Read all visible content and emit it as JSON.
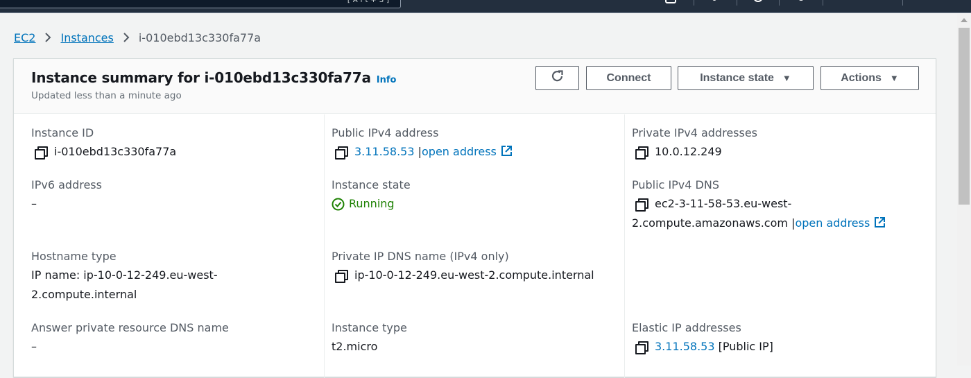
{
  "topnav": {
    "search_shortcut": "[Alt+S]",
    "icons": [
      "cloudshell-icon",
      "notifications-icon",
      "help-icon",
      "settings-icon"
    ]
  },
  "breadcrumb": {
    "items": [
      {
        "label": "EC2",
        "link": true
      },
      {
        "label": "Instances",
        "link": true
      },
      {
        "label": "i-010ebd13c330fa77a",
        "link": false
      }
    ]
  },
  "summary": {
    "title": "Instance summary for i-010ebd13c330fa77a",
    "info_label": "Info",
    "subtitle": "Updated less than a minute ago",
    "buttons": {
      "refresh": "refresh-icon",
      "connect": "Connect",
      "instance_state": "Instance state",
      "actions": "Actions"
    }
  },
  "details": {
    "instance_id": {
      "label": "Instance ID",
      "value": "i-010ebd13c330fa77a"
    },
    "public_ipv4": {
      "label": "Public IPv4 address",
      "value": "3.11.58.53",
      "link_label": "open address"
    },
    "private_ipv4": {
      "label": "Private IPv4 addresses",
      "value": "10.0.12.249"
    },
    "ipv6": {
      "label": "IPv6 address",
      "value": "–"
    },
    "instance_state": {
      "label": "Instance state",
      "value": "Running",
      "color": "#1d8102"
    },
    "public_dns": {
      "label": "Public IPv4 DNS",
      "value_line1": "ec2-3-11-58-53.eu-west-",
      "value_line2": "2.compute.amazonaws.com",
      "link_label": "open address"
    },
    "hostname_type": {
      "label": "Hostname type",
      "value_line1": "IP name: ip-10-0-12-249.eu-west-",
      "value_line2": "2.compute.internal"
    },
    "private_dns": {
      "label": "Private IP DNS name (IPv4 only)",
      "value": "ip-10-0-12-249.eu-west-2.compute.internal"
    },
    "answer_dns": {
      "label": "Answer private resource DNS name",
      "value": "–"
    },
    "instance_type": {
      "label": "Instance type",
      "value": "t2.micro"
    },
    "elastic_ip": {
      "label": "Elastic IP addresses",
      "value": "3.11.58.53",
      "suffix": "[Public IP]"
    }
  },
  "colors": {
    "link": "#0073bb",
    "running": "#1d8102",
    "nav_bg": "#232f3e"
  }
}
